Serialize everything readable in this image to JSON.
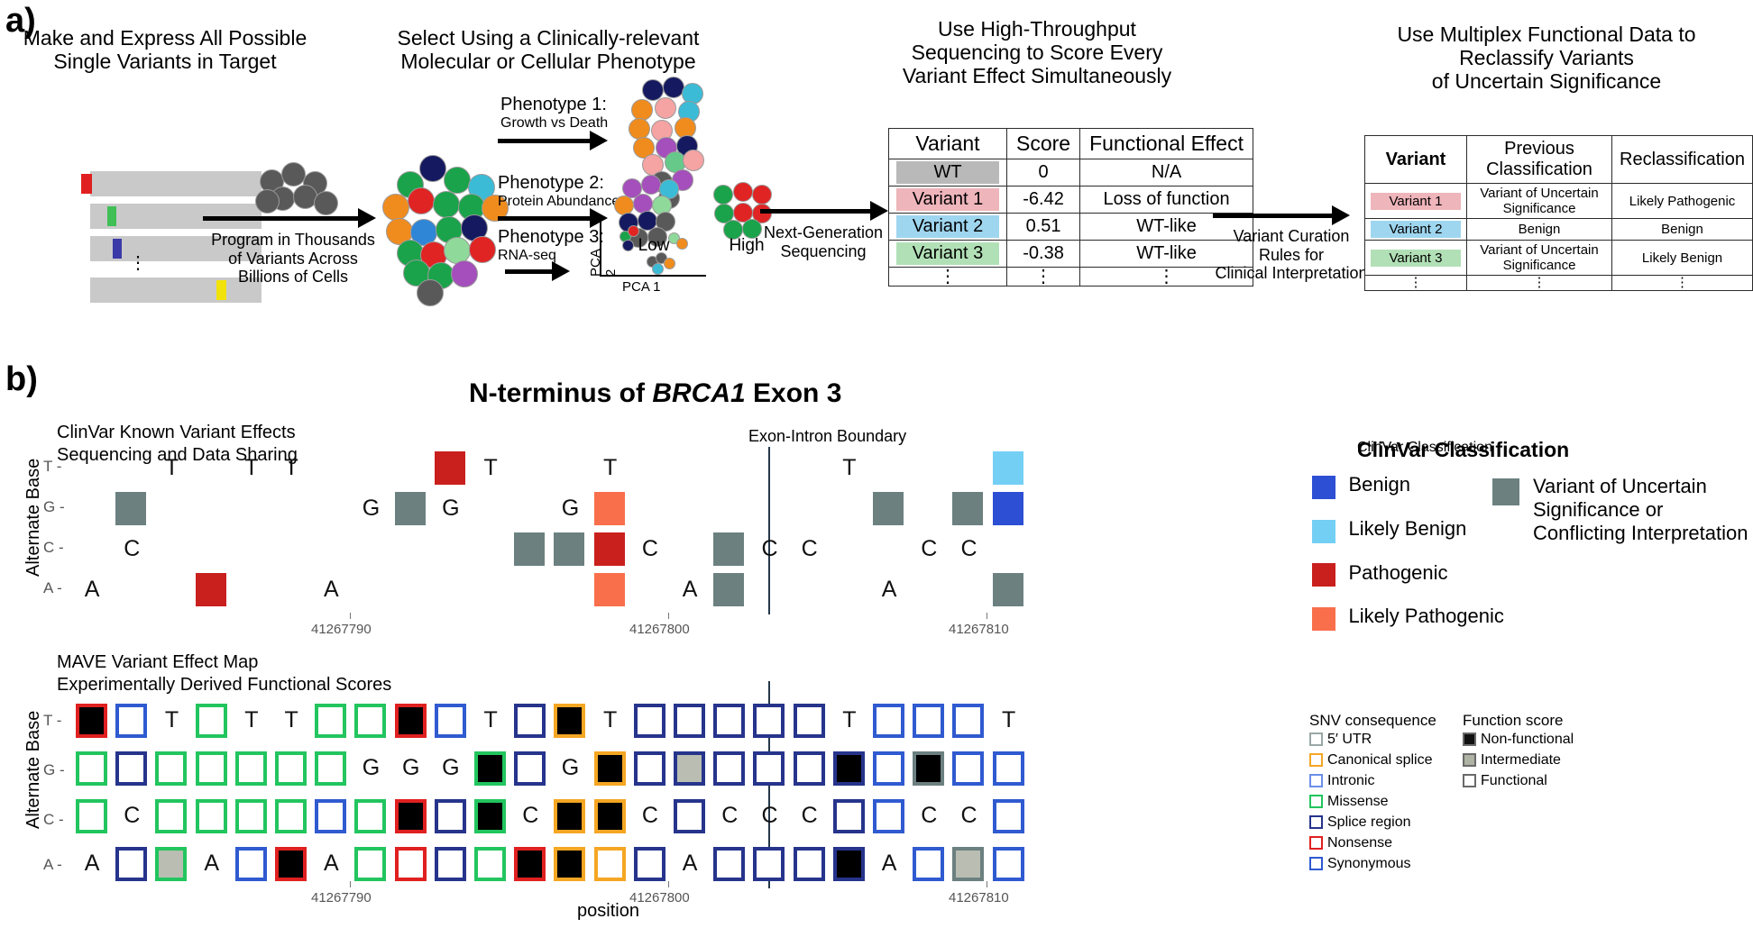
{
  "panels": {
    "a_label": "a)",
    "b_label": "b)"
  },
  "panel_a": {
    "columns": [
      {
        "title_lines": [
          "Make and Express All Possible",
          "Single Variants in Target"
        ]
      },
      {
        "title_lines": [
          "Select Using a Clinically-relevant",
          "Molecular or Cellular Phenotype"
        ]
      },
      {
        "title_lines": [
          "Use High-Throughput",
          "Sequencing to Score Every",
          "Variant Effect Simultaneously"
        ]
      },
      {
        "title_lines": [
          "Use Multiplex Functional Data to",
          "Reclassify Variants",
          "of Uncertain Significance"
        ]
      }
    ],
    "arrow1_caption": [
      "Program in Thousands",
      "of Variants Across",
      "Billions of Cells"
    ],
    "arrow2_caption": [
      "Next-Generation",
      "Sequencing"
    ],
    "arrow3_caption": [
      "Variant Curation",
      "Rules for",
      "Clinical Interpretation"
    ],
    "phenotypes": [
      {
        "name": "Phenotype 1:",
        "sub": "Growth vs Death"
      },
      {
        "name": "Phenotype 2:",
        "sub": "Protein Abundance"
      },
      {
        "name": "Phenotype 3:",
        "sub": "RNA-seq"
      }
    ],
    "phenotype2_labels": [
      "Low",
      "High"
    ],
    "pca_axis_x": "PCA 1",
    "pca_axis_y": "PCA 2",
    "ellipsis": "⋮",
    "table_score": {
      "headers": [
        "Variant",
        "Score",
        "Functional Effect"
      ],
      "rows": [
        {
          "variant": "WT",
          "color": "#b9b9b9",
          "score": "0",
          "effect": "N/A"
        },
        {
          "variant": "Variant 1",
          "color": "#eeb5bb",
          "score": "-6.42",
          "effect": "Loss of function"
        },
        {
          "variant": "Variant 2",
          "color": "#9fd6ef",
          "score": "0.51",
          "effect": "WT-like"
        },
        {
          "variant": "Variant 3",
          "color": "#b2e0b6",
          "score": "-0.38",
          "effect": "WT-like"
        },
        {
          "variant": "⋮",
          "color": "transparent",
          "score": "⋮",
          "effect": "⋮"
        }
      ]
    },
    "table_reclass": {
      "headers": [
        "Variant",
        "Previous Classification",
        "Reclassification"
      ],
      "rows": [
        {
          "variant": "Variant 1",
          "color": "#eeb5bb",
          "previous": "Variant of Uncertain Significance",
          "reclass": "Likely Pathogenic"
        },
        {
          "variant": "Variant 2",
          "color": "#9fd6ef",
          "previous": "Benign",
          "reclass": "Benign"
        },
        {
          "variant": "Variant 3",
          "color": "#b2e0b6",
          "previous": "Variant of Uncertain Significance",
          "reclass": "Likely Benign"
        },
        {
          "variant": "⋮",
          "color": "transparent",
          "previous": "⋮",
          "reclass": "⋮"
        }
      ]
    }
  },
  "panel_b": {
    "title_parts": {
      "pre": "N-terminus of ",
      "gene": "BRCA1",
      "post": " Exon 3"
    },
    "clinvar_caption": [
      "ClinVar Known Variant Effects",
      "Sequencing and Data Sharing"
    ],
    "mave_caption": [
      "MAVE Variant Effect Map",
      "Experimentally Derived Functional Scores"
    ],
    "boundary_label": "Exon-Intron Boundary",
    "y_axis_label": "Alternate Base",
    "x_axis_label": "position",
    "row_labels": [
      "T -",
      "G -",
      "C -",
      "A -"
    ],
    "position_ticks": [
      "41267790",
      "41267800",
      "41267810"
    ],
    "clinvar_legend": {
      "title": "ClinVar Classification",
      "items": [
        {
          "label": "Benign",
          "color": "#2d4fd4"
        },
        {
          "label": "Likely Benign",
          "color": "#74cff5"
        },
        {
          "label": "Pathogenic",
          "color": "#c9201d"
        },
        {
          "label": "Likely Pathogenic",
          "color": "#f96f4c"
        }
      ],
      "vus": {
        "label_lines": [
          "Variant of Uncertain",
          "Significance or",
          "Conflicting Interpretation"
        ],
        "color": "#6c8080"
      }
    },
    "mave_legend": {
      "consequence_title": "SNV consequence",
      "consequence": [
        {
          "label": "5′ UTR",
          "color": "#9aa7a7"
        },
        {
          "label": "Canonical splice",
          "color": "#f5a623"
        },
        {
          "label": "Intronic",
          "color": "#6b8fe8"
        },
        {
          "label": "Missense",
          "color": "#22c55e"
        },
        {
          "label": "Splice region",
          "color": "#26348c"
        },
        {
          "label": "Nonsense",
          "color": "#e02020"
        },
        {
          "label": "Synonymous",
          "color": "#2f5ad0"
        }
      ],
      "score_title": "Function score",
      "scores": [
        {
          "label": "Non-functional",
          "fill": "#111111"
        },
        {
          "label": "Intermediate",
          "fill": "#aeb3a4"
        },
        {
          "label": "Functional",
          "fill": "#ffffff"
        }
      ]
    }
  },
  "chart_data": {
    "type": "heatmap",
    "title": "N-terminus of BRCA1 Exon 3",
    "xlabel": "position",
    "ylabel": "Alternate Base",
    "rows": [
      "T",
      "G",
      "C",
      "A"
    ],
    "n_columns": 24,
    "boundary_after_column": 13,
    "position_tick_columns": {
      "41267790": 7,
      "41267800": 15,
      "41267810": 23
    },
    "clinvar_panel": {
      "name": "ClinVar Known Variant Effects",
      "reference_base_by_column": [
        "A",
        "C",
        "T",
        "A",
        "T",
        "T",
        "A",
        "G",
        "G",
        "G",
        "T",
        "C",
        "G",
        "T",
        "C",
        "A",
        "C",
        "C",
        "C",
        "T",
        "A",
        "C",
        "C",
        "T"
      ],
      "cells": [
        {
          "col": 1,
          "row": "G",
          "class": "vus"
        },
        {
          "col": 3,
          "row": "A",
          "class": "pathogenic"
        },
        {
          "col": 8,
          "row": "G",
          "class": "vus"
        },
        {
          "col": 9,
          "row": "T",
          "class": "pathogenic"
        },
        {
          "col": 11,
          "row": "C",
          "class": "vus"
        },
        {
          "col": 12,
          "row": "C",
          "class": "vus"
        },
        {
          "col": 13,
          "row": "G",
          "class": "likely_pathogenic"
        },
        {
          "col": 13,
          "row": "C",
          "class": "pathogenic"
        },
        {
          "col": 13,
          "row": "A",
          "class": "likely_pathogenic"
        },
        {
          "col": 16,
          "row": "C",
          "class": "vus"
        },
        {
          "col": 16,
          "row": "A",
          "class": "vus"
        },
        {
          "col": 20,
          "row": "G",
          "class": "vus"
        },
        {
          "col": 22,
          "row": "G",
          "class": "vus"
        },
        {
          "col": 23,
          "row": "T",
          "class": "likely_benign"
        },
        {
          "col": 23,
          "row": "G",
          "class": "benign"
        },
        {
          "col": 23,
          "row": "A",
          "class": "vus"
        }
      ]
    },
    "mave_panel": {
      "name": "MAVE Variant Effect Map",
      "consequence_by_column": [
        "nonsense_mix",
        "splice_region",
        "missense",
        "missense",
        "missense",
        "missense",
        "missense",
        "missense",
        "nonsense",
        "splice_region",
        "missense",
        "splice_region",
        "canonical_splice",
        "canonical_splice",
        "splice_region",
        "splice_region",
        "splice_region",
        "splice_region",
        "splice_region",
        "splice_region",
        "intronic",
        "intronic",
        "intronic",
        "intronic"
      ],
      "score_values": [
        "functional",
        "intermediate",
        "non-functional"
      ]
    }
  }
}
